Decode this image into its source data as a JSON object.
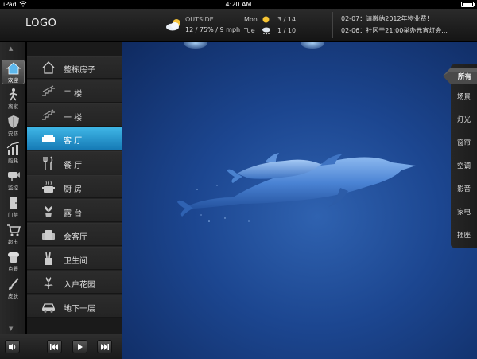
{
  "status": {
    "carrier": "iPad",
    "time": "4:20 AM",
    "battery_level": 0.85
  },
  "header": {
    "logo": "LOGO",
    "outside_label": "OUTSIDE",
    "outside_value": "12  /  75% / 9 mph",
    "forecast": [
      {
        "day": "Mon",
        "icon": "sun-icon",
        "temp": "3  /  14"
      },
      {
        "day": "Tue",
        "icon": "snow-cloud-icon",
        "temp": "1  /  10"
      }
    ],
    "notices": [
      "02-07：请缴纳2012年物业费！",
      "02-06：社区于21:00举办元宵灯会..."
    ]
  },
  "rail": {
    "items": [
      {
        "label": "欢迎",
        "icon": "home-icon",
        "active": true
      },
      {
        "label": "离家",
        "icon": "walking-person-icon",
        "active": false
      },
      {
        "label": "安防",
        "icon": "shield-icon",
        "active": false
      },
      {
        "label": "能耗",
        "icon": "energy-chart-icon",
        "active": false
      },
      {
        "label": "监控",
        "icon": "camera-icon",
        "active": false
      },
      {
        "label": "门禁",
        "icon": "door-icon",
        "active": false
      },
      {
        "label": "超市",
        "icon": "cart-icon",
        "active": false
      },
      {
        "label": "点餐",
        "icon": "chef-icon",
        "active": false
      },
      {
        "label": "皮肤",
        "icon": "brush-icon",
        "active": false
      }
    ]
  },
  "rooms": [
    {
      "label": "整栋房子",
      "icon": "house-icon",
      "active": false
    },
    {
      "label": "二  楼",
      "icon": "stairs-icon",
      "active": false
    },
    {
      "label": "一  楼",
      "icon": "stairs-icon",
      "active": false
    },
    {
      "label": "客  厅",
      "icon": "sofa-icon",
      "active": true
    },
    {
      "label": "餐  厅",
      "icon": "cutlery-icon",
      "active": false
    },
    {
      "label": "厨  房",
      "icon": "pot-icon",
      "active": false
    },
    {
      "label": "露  台",
      "icon": "plant-icon",
      "active": false
    },
    {
      "label": "会客厅",
      "icon": "armchair-icon",
      "active": false
    },
    {
      "label": "卫生间",
      "icon": "toothbrush-icon",
      "active": false
    },
    {
      "label": "入户花园",
      "icon": "flower-icon",
      "active": false
    },
    {
      "label": "地下一层",
      "icon": "car-icon",
      "active": false
    }
  ],
  "filters": {
    "active": "所有",
    "items": [
      "场景",
      "灯光",
      "窗帘",
      "空调",
      "影音",
      "家电",
      "插座"
    ]
  },
  "controls": {
    "volume_icon": "speaker-icon",
    "prev_icon": "previous-icon",
    "play_icon": "play-icon",
    "next_icon": "next-icon"
  }
}
